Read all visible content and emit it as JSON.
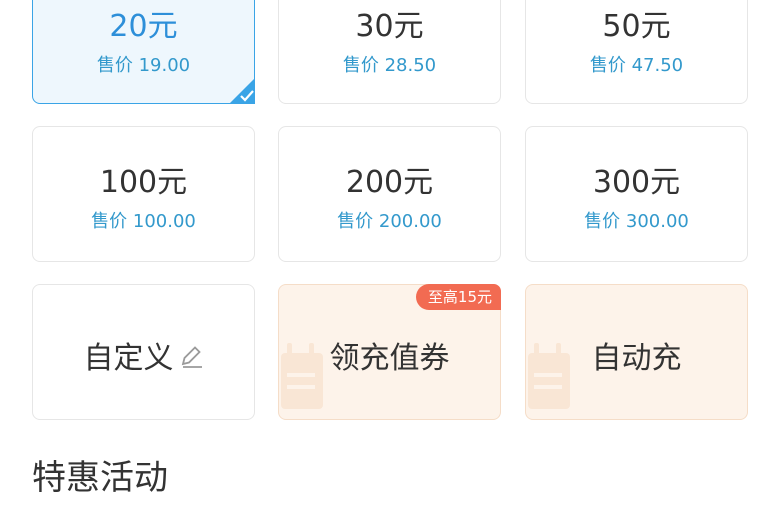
{
  "options": [
    {
      "amount": "20元",
      "price": "售价 19.00"
    },
    {
      "amount": "30元",
      "price": "售价 28.50"
    },
    {
      "amount": "50元",
      "price": "售价 47.50"
    },
    {
      "amount": "100元",
      "price": "售价 100.00"
    },
    {
      "amount": "200元",
      "price": "售价 200.00"
    },
    {
      "amount": "300元",
      "price": "售价 300.00"
    }
  ],
  "custom_label": "自定义",
  "coupon": {
    "label": "领充值券",
    "badge": "至高15元"
  },
  "auto_recharge_label": "自动充",
  "section_title": "特惠活动",
  "colors": {
    "accent": "#3aa4e6",
    "badge": "#f26b52",
    "price": "#3399cc"
  }
}
